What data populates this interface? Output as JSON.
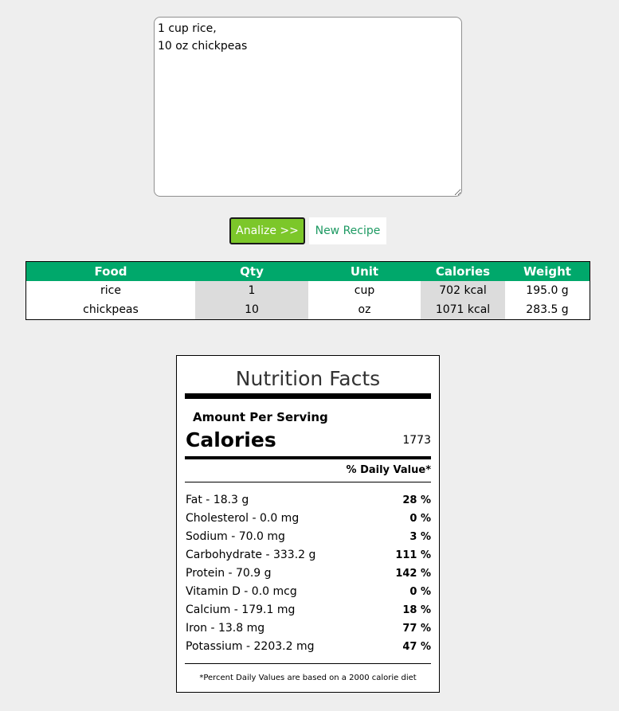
{
  "recipe": {
    "text": "1 cup rice,\n10 oz chickpeas"
  },
  "buttons": {
    "analyze_label": "Analize >>",
    "new_recipe_label": "New Recipe"
  },
  "table": {
    "headers": [
      "Food",
      "Qty",
      "Unit",
      "Calories",
      "Weight"
    ],
    "rows": [
      [
        "rice",
        "1",
        "cup",
        "702 kcal",
        "195.0 g"
      ],
      [
        "chickpeas",
        "10",
        "oz",
        "1071 kcal",
        "283.5 g"
      ]
    ]
  },
  "nutrition": {
    "title": "Nutrition Facts",
    "amount_per_serving": "Amount Per Serving",
    "calories_label": "Calories",
    "calories_value": "1773",
    "daily_value_label": "% Daily Value*",
    "nutrients": [
      {
        "label": "Fat - 18.3 g",
        "pct": "28 %"
      },
      {
        "label": "Cholesterol - 0.0 mg",
        "pct": "0 %"
      },
      {
        "label": "Sodium - 70.0 mg",
        "pct": "3 %"
      },
      {
        "label": "Carbohydrate - 333.2 g",
        "pct": "111 %"
      },
      {
        "label": "Protein - 70.9 g",
        "pct": "142 %"
      },
      {
        "label": "Vitamin D - 0.0 mcg",
        "pct": "0 %"
      },
      {
        "label": "Calcium - 179.1 mg",
        "pct": "18 %"
      },
      {
        "label": "Iron - 13.8 mg",
        "pct": "77 %"
      },
      {
        "label": "Potassium - 2203.2 mg",
        "pct": "47 %"
      }
    ],
    "footnote": "*Percent Daily Values are based on a 2000 calorie diet"
  },
  "colors": {
    "table_header_bg": "#00a86b",
    "analyze_button_bg": "#7cc72a",
    "new_recipe_text": "#1e9a63"
  }
}
